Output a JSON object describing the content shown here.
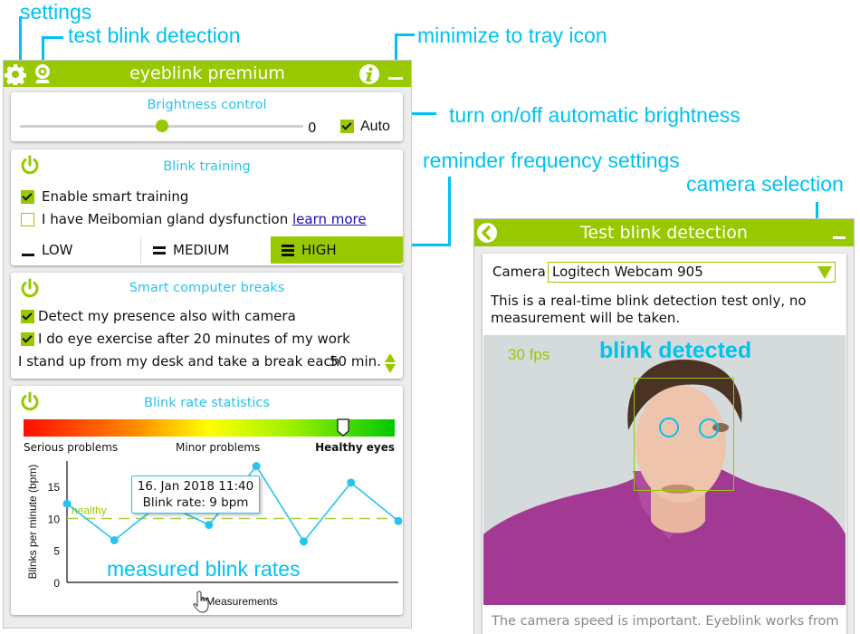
{
  "annotations": {
    "settings": "settings",
    "test_blink": "test blink detection",
    "minimize": "minimize to tray icon",
    "auto_brightness": "turn on/off automatic brightness",
    "reminder_frequency": "reminder frequency settings",
    "camera_selection": "camera selection",
    "measured_rates": "measured blink rates"
  },
  "main_window": {
    "title": "eyeblink premium",
    "brightness": {
      "title": "Brightness control",
      "value": "0",
      "slider_fraction": 0.5,
      "auto_label": "Auto",
      "auto_checked": true
    },
    "blink_training": {
      "title": "Blink training",
      "enabled": true,
      "smart_training_label": "Enable smart training",
      "smart_training_checked": true,
      "meibomian_label": "I have Meibomian gland dysfunction",
      "meibomian_checked": false,
      "learn_more": "learn more",
      "frequency": [
        {
          "label": "LOW",
          "selected": false
        },
        {
          "label": "MEDIUM",
          "selected": false
        },
        {
          "label": "HIGH",
          "selected": true
        }
      ]
    },
    "breaks": {
      "title": "Smart computer breaks",
      "enabled": true,
      "camera_presence_label": "Detect my presence also with camera",
      "camera_presence_checked": true,
      "eye_exercise_label": "I do eye exercise after 20 minutes of my work",
      "eye_exercise_checked": true,
      "stand_up_label": "I stand up from my desk and take a break each",
      "interval": "50 min."
    },
    "statistics": {
      "title": "Blink rate statistics",
      "enabled": true,
      "health_scale": {
        "labels": [
          "Serious problems",
          "Minor problems",
          "Healthy eyes"
        ],
        "marker_fraction": 0.86
      },
      "tooltip": {
        "date": "16. Jan 2018 11:40",
        "rate": "Blink rate: 9 bpm"
      }
    }
  },
  "chart_data": {
    "type": "line",
    "title": "",
    "xlabel": "Measurements",
    "ylabel": "Blinks per minute (bpm)",
    "ylim": [
      0,
      19
    ],
    "yticks": [
      0,
      5,
      10,
      15
    ],
    "x": [
      0,
      1,
      2,
      3,
      4,
      5,
      6,
      7
    ],
    "values": [
      12.3,
      6.6,
      12.5,
      9.0,
      18.2,
      6.4,
      15.6,
      9.6
    ],
    "reference_line": {
      "value": 10,
      "label": "healthy"
    },
    "highlighted_index": 3
  },
  "test_window": {
    "title": "Test blink detection",
    "camera_label": "Camera",
    "camera_value": "Logitech Webcam 905",
    "info": "This is a real-time blink detection test only, no measurement will be taken.",
    "fps": "30 fps",
    "status": "blink detected",
    "footnote": "The camera speed is important. Eyeblink works from"
  }
}
